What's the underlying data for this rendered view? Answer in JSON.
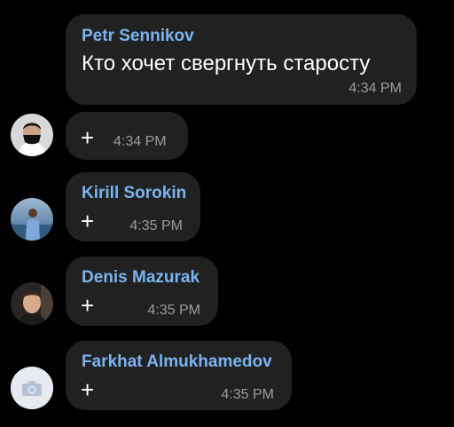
{
  "colors": {
    "background": "#000000",
    "bubble": "#212121",
    "sender_name": "#7ab4f0",
    "text": "#ffffff",
    "time": "#9b9b9b"
  },
  "messages": [
    {
      "sender": "Petr Sennikov",
      "text": "Кто хочет свергнуть старосту",
      "time": "4:34 PM"
    },
    {
      "text": "+",
      "time": "4:34 PM",
      "avatar": "masked-person-photo"
    },
    {
      "sender": "Kirill Sorokin",
      "text": "+",
      "time": "4:35 PM",
      "avatar": "person-by-water-photo"
    },
    {
      "sender": "Denis Mazurak",
      "text": "+",
      "time": "4:35 PM",
      "avatar": "person-portrait-photo"
    },
    {
      "sender": "Farkhat Almukhamedov",
      "text": "+",
      "time": "4:35 PM",
      "avatar": "camera-icon"
    }
  ]
}
